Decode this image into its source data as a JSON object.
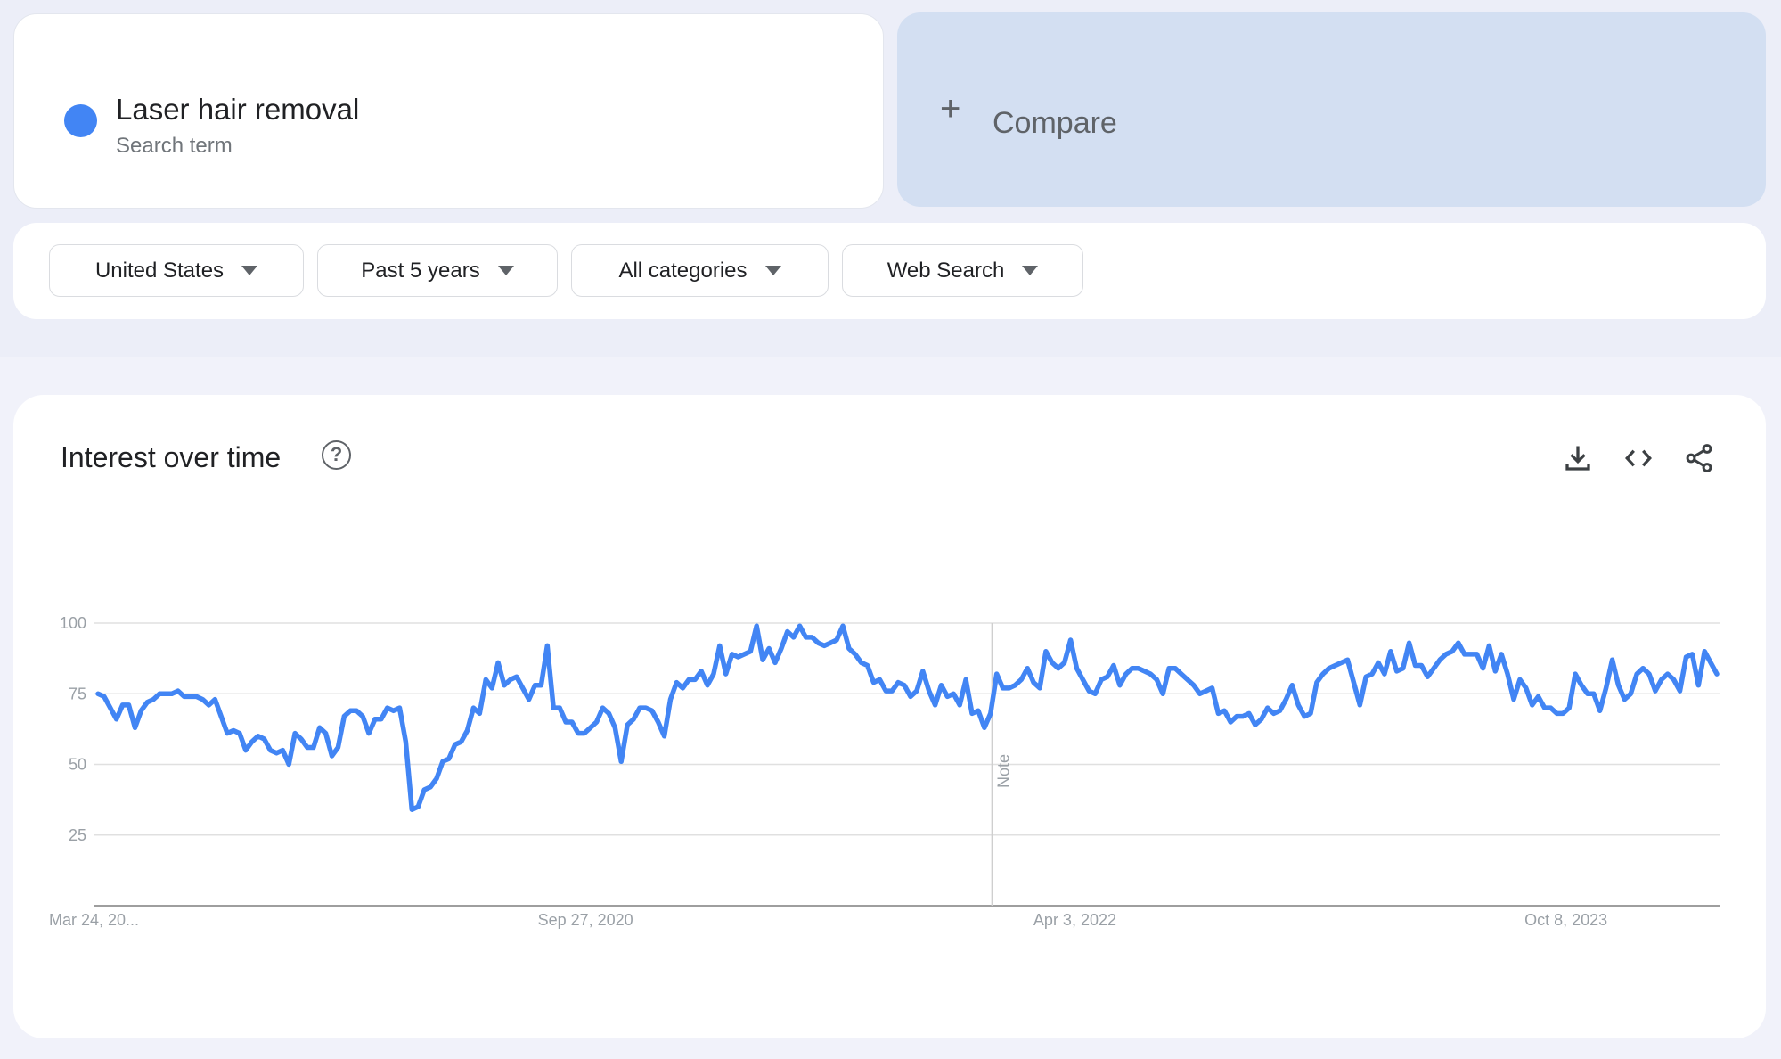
{
  "search_term": {
    "name": "Laser hair removal",
    "type_label": "Search term",
    "color": "#4285f4"
  },
  "compare": {
    "label": "Compare",
    "icon": "plus-icon"
  },
  "filters": [
    {
      "label": "United States"
    },
    {
      "label": "Past 5 years"
    },
    {
      "label": "All categories"
    },
    {
      "label": "Web Search"
    }
  ],
  "chart_section": {
    "title": "Interest over time",
    "help_icon": "?",
    "actions": [
      "download-icon",
      "embed-code-icon",
      "share-icon"
    ],
    "note_label": "Note"
  },
  "chart_data": {
    "type": "line",
    "title": "Interest over time",
    "xlabel": "",
    "ylabel": "",
    "ylim": [
      0,
      100
    ],
    "yticks": [
      25,
      50,
      75,
      100
    ],
    "x_tick_labels": [
      "Mar 24, 20...",
      "Sep 27, 2020",
      "Apr 3, 2022",
      "Oct 8, 2023"
    ],
    "x_tick_fraction": [
      0.0,
      0.302,
      0.603,
      0.905
    ],
    "note_fraction": 0.552,
    "grid": true,
    "legend": "none",
    "series": [
      {
        "name": "Laser hair removal",
        "color": "#4285f4",
        "values": [
          75,
          74,
          70,
          66,
          71,
          71,
          63,
          69,
          72,
          73,
          75,
          75,
          75,
          76,
          74,
          74,
          74,
          73,
          71,
          73,
          67,
          61,
          62,
          61,
          55,
          58,
          60,
          59,
          55,
          54,
          55,
          50,
          61,
          59,
          56,
          56,
          63,
          61,
          53,
          56,
          67,
          69,
          69,
          67,
          61,
          66,
          66,
          70,
          69,
          70,
          58,
          34,
          35,
          41,
          42,
          45,
          51,
          52,
          57,
          58,
          62,
          70,
          68,
          80,
          77,
          86,
          78,
          80,
          81,
          77,
          73,
          78,
          78,
          92,
          70,
          70,
          65,
          65,
          61,
          61,
          63,
          65,
          70,
          68,
          63,
          51,
          64,
          66,
          70,
          70,
          69,
          65,
          60,
          73,
          79,
          77,
          80,
          80,
          83,
          78,
          82,
          92,
          82,
          89,
          88,
          89,
          90,
          99,
          87,
          91,
          86,
          91,
          97,
          95,
          99,
          95,
          95,
          93,
          92,
          93,
          94,
          99,
          91,
          89,
          86,
          85,
          79,
          80,
          76,
          76,
          79,
          78,
          74,
          76,
          83,
          76,
          71,
          78,
          74,
          75,
          71,
          80,
          68,
          69,
          63,
          68,
          82,
          77,
          77,
          78,
          80,
          84,
          79,
          77,
          90,
          86,
          84,
          86,
          94,
          84,
          80,
          76,
          75,
          80,
          81,
          85,
          78,
          82,
          84,
          84,
          83,
          82,
          80,
          75,
          84,
          84,
          82,
          80,
          78,
          75,
          76,
          77,
          68,
          69,
          65,
          67,
          67,
          68,
          64,
          66,
          70,
          68,
          69,
          73,
          78,
          71,
          67,
          68,
          79,
          82,
          84,
          85,
          86,
          87,
          79,
          71,
          81,
          82,
          86,
          82,
          90,
          83,
          84,
          93,
          85,
          85,
          81,
          84,
          87,
          89,
          90,
          93,
          89,
          89,
          89,
          84,
          92,
          83,
          89,
          82,
          73,
          80,
          77,
          71,
          74,
          70,
          70,
          68,
          68,
          70,
          82,
          78,
          75,
          75,
          69,
          77,
          87,
          78,
          73,
          75,
          82,
          84,
          82,
          76,
          80,
          82,
          80,
          76,
          88,
          89,
          78,
          90,
          86,
          82
        ]
      }
    ]
  }
}
